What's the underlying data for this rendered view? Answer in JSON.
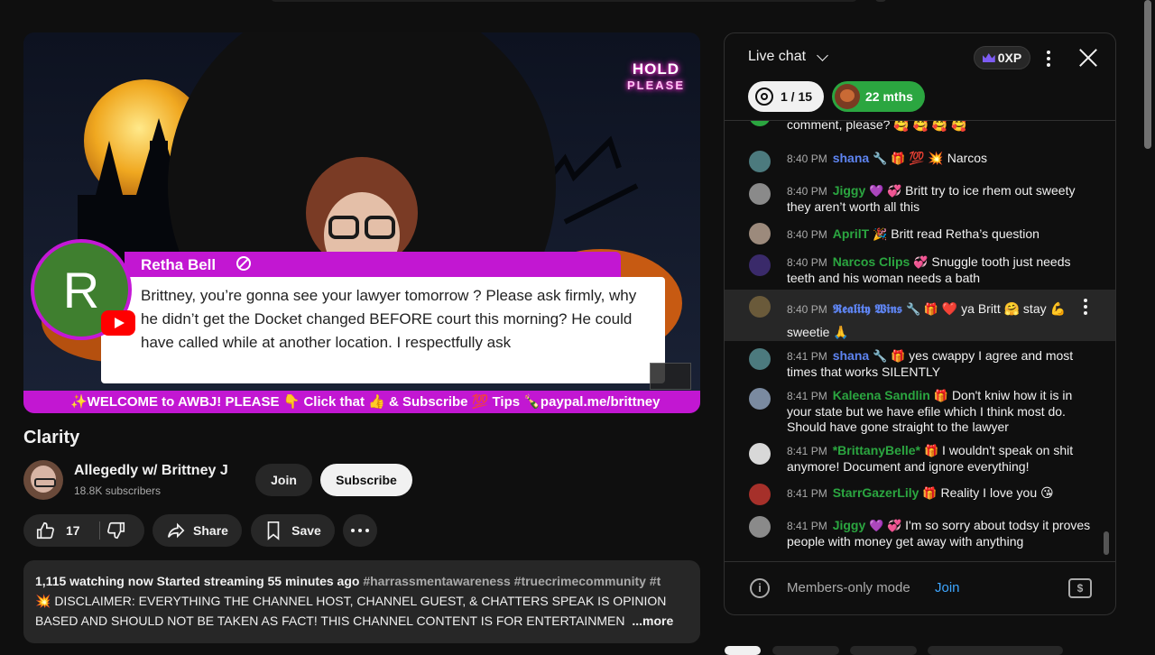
{
  "video": {
    "hold_line1": "HOLD",
    "hold_line2": "PLEASE",
    "avatar_letter": "R",
    "guest_name": "Retha Bell",
    "guest_message": "Brittney, you’re gonna see your lawyer tomorrow ? Please ask firmly, why he didn’t get the Docket changed BEFORE court this morning? He could have called while at another location. I respectfully ask",
    "ticker": "✨WELCOME to AWBJ! PLEASE 👇 Click that 👍 & Subscribe 💯 Tips 🍾paypal.me/brittney"
  },
  "meta": {
    "title": "Clarity",
    "channel_name": "Allegedly w/ Brittney J",
    "subscribers": "18.8K subscribers",
    "join_label": "Join",
    "subscribe_label": "Subscribe",
    "like_count": "17",
    "share_label": "Share",
    "save_label": "Save"
  },
  "description": {
    "stats": "1,115 watching now  Started streaming 55 minutes ago",
    "tags": "#harrassmentawareness #truecrimecommunity #t",
    "line2": "💥 DISCLAIMER: EVERYTHING THE CHANNEL HOST, CHANNEL GUEST, & CHATTERS SPEAK IS OPINION",
    "line3": "BASED AND SHOULD NOT BE TAKEN AS FACT!  THIS CHANNEL CONTENT IS FOR ENTERTAINMEN",
    "more": "...more"
  },
  "chat": {
    "title": "Live chat",
    "xp": "0XP",
    "goal": "1 / 15",
    "months": "22 mths",
    "members_mode": "Members-only mode",
    "members_join": "Join",
    "messages": [
      {
        "time": "",
        "author": "",
        "text": "comment, please? 🥰 🥰 🥰 🥰"
      },
      {
        "time": "8:40 PM",
        "author": "shana",
        "badges": "🔧 🎁",
        "text": "💯 💥  Narcos"
      },
      {
        "time": "8:40 PM",
        "author": "Jiggy",
        "badges": "💜 💞",
        "text": "Britt try to ice rhem out sweety they aren’t worth all this"
      },
      {
        "time": "8:40 PM",
        "author": "AprilT",
        "badges": "🎉",
        "text": "Britt read Retha’s question"
      },
      {
        "time": "8:40 PM",
        "author": "Narcos Clips",
        "badges": "💞",
        "text": "Snuggle tooth just needs teeth and his woman needs a bath"
      },
      {
        "time": "8:40 PM",
        "author": "𝕽𝖊𝖆𝖑𝖎𝖙𝖞 𝖂𝖎𝖓𝖘",
        "badges": "🔧 🎁",
        "text": "❤️  ya Britt 🤗  stay 💪 sweetie 🙏"
      },
      {
        "time": "8:41 PM",
        "author": "shana",
        "badges": "🔧 🎁",
        "text": "yes cwappy I agree and most times that works SILENTLY"
      },
      {
        "time": "8:41 PM",
        "author": "Kaleena Sandlin",
        "badges": "🎁",
        "text": "Don't kniw how it is in your state but we have efile which I think most do. Should have gone straight to the lawyer"
      },
      {
        "time": "8:41 PM",
        "author": "*BrittanyBelle*",
        "badges": "🎁",
        "text": "I wouldn't speak on shit anymore! Document and ignore everything!"
      },
      {
        "time": "8:41 PM",
        "author": "StarrGazerLily",
        "badges": "🎁",
        "text": "Reality I love you 😘"
      },
      {
        "time": "8:41 PM",
        "author": "Jiggy",
        "badges": "💜 💞",
        "text": "I'm so sorry about todsy it proves people with money get away with anything"
      }
    ]
  },
  "colors": {
    "accent_purple": "#c217d2",
    "subscribe_bg": "#f1f1f1",
    "author_blue": "#5e84f1",
    "author_green": "#2ba640",
    "link_blue": "#3ea6ff"
  }
}
